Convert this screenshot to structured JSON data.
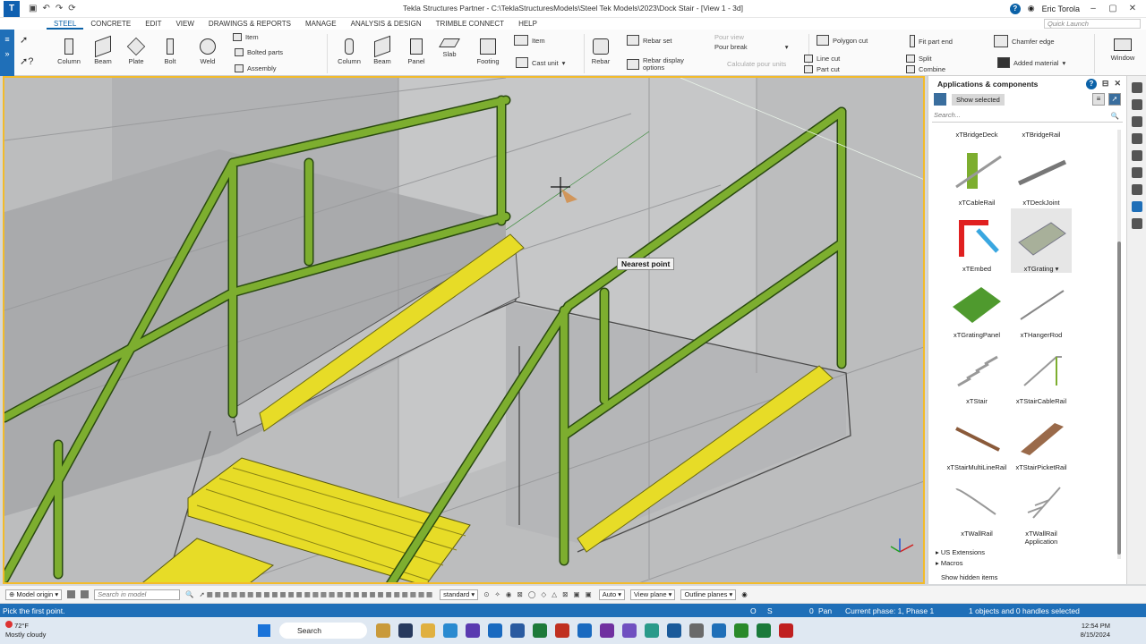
{
  "titlebar": {
    "title": "Tekla Structures Partner - C:\\TeklaStructuresModels\\Steel Tek Models\\2023\\Dock Stair - [View 1 - 3d]",
    "user": "Eric Torola"
  },
  "tabs": [
    "STEEL",
    "CONCRETE",
    "EDIT",
    "VIEW",
    "DRAWINGS & REPORTS",
    "MANAGE",
    "ANALYSIS & DESIGN",
    "TRIMBLE CONNECT",
    "HELP"
  ],
  "quick_launch_placeholder": "Quick Launch",
  "ribbon": {
    "steel": {
      "column": "Column",
      "beam": "Beam",
      "plate": "Plate",
      "bolt": "Bolt",
      "weld": "Weld",
      "item": "Item",
      "bolted_parts": "Bolted parts",
      "assembly": "Assembly"
    },
    "concrete": {
      "column": "Column",
      "beam": "Beam",
      "panel": "Panel",
      "slab": "Slab",
      "footing": "Footing",
      "item": "Item",
      "cast_unit": "Cast unit"
    },
    "rebar": {
      "rebar": "Rebar",
      "rebar_set": "Rebar set",
      "rebar_display": "Rebar display options",
      "pour_view": "Pour view",
      "pour_break": "Pour break",
      "calc_pour": "Calculate pour units"
    },
    "edit": {
      "polygon_cut": "Polygon cut",
      "line_cut": "Line cut",
      "part_cut": "Part cut",
      "fit_part_end": "Fit part end",
      "split": "Split",
      "combine": "Combine",
      "chamfer_edge": "Chamfer edge",
      "added_material": "Added material",
      "window": "Window"
    }
  },
  "viewport": {
    "snap_tooltip": "Nearest point"
  },
  "panel": {
    "title": "Applications & components",
    "show_selected": "Show selected",
    "search_placeholder": "Search...",
    "components": [
      "xTBridgeDeck",
      "xTBridgeRail",
      "xTCableRail",
      "xTDeckJoint",
      "xTEmbed",
      "xTGrating",
      "xTGratingPanel",
      "xTHangerRod",
      "xTStair",
      "xTStairCableRail",
      "xTStairMultiLineRail",
      "xTStairPicketRail",
      "xTWallRail",
      "xTWallRail Application"
    ],
    "tree": [
      "US Extensions",
      "Macros"
    ],
    "show_hidden": "Show hidden items"
  },
  "bottombar": {
    "model_origin": "Model origin",
    "search_placeholder": "Search in model",
    "standard": "standard",
    "auto": "Auto",
    "view_plane": "View plane",
    "outline_planes": "Outline planes"
  },
  "status": {
    "prompt": "Pick the first point.",
    "o": "O",
    "s": "S",
    "pan_value": "0",
    "pan": "Pan",
    "phase": "Current phase: 1, Phase 1",
    "selection": "1 objects and 0 handles selected"
  },
  "taskbar": {
    "temp": "72°F",
    "weather": "Mostly cloudy",
    "search": "Search",
    "time": "12:54 PM",
    "date": "8/15/2024"
  },
  "colors": {
    "accent": "#1f6fb8",
    "rail": "#7dae2f",
    "nosing": "#e7dc27",
    "viewport_border": "#f3bb2a"
  }
}
